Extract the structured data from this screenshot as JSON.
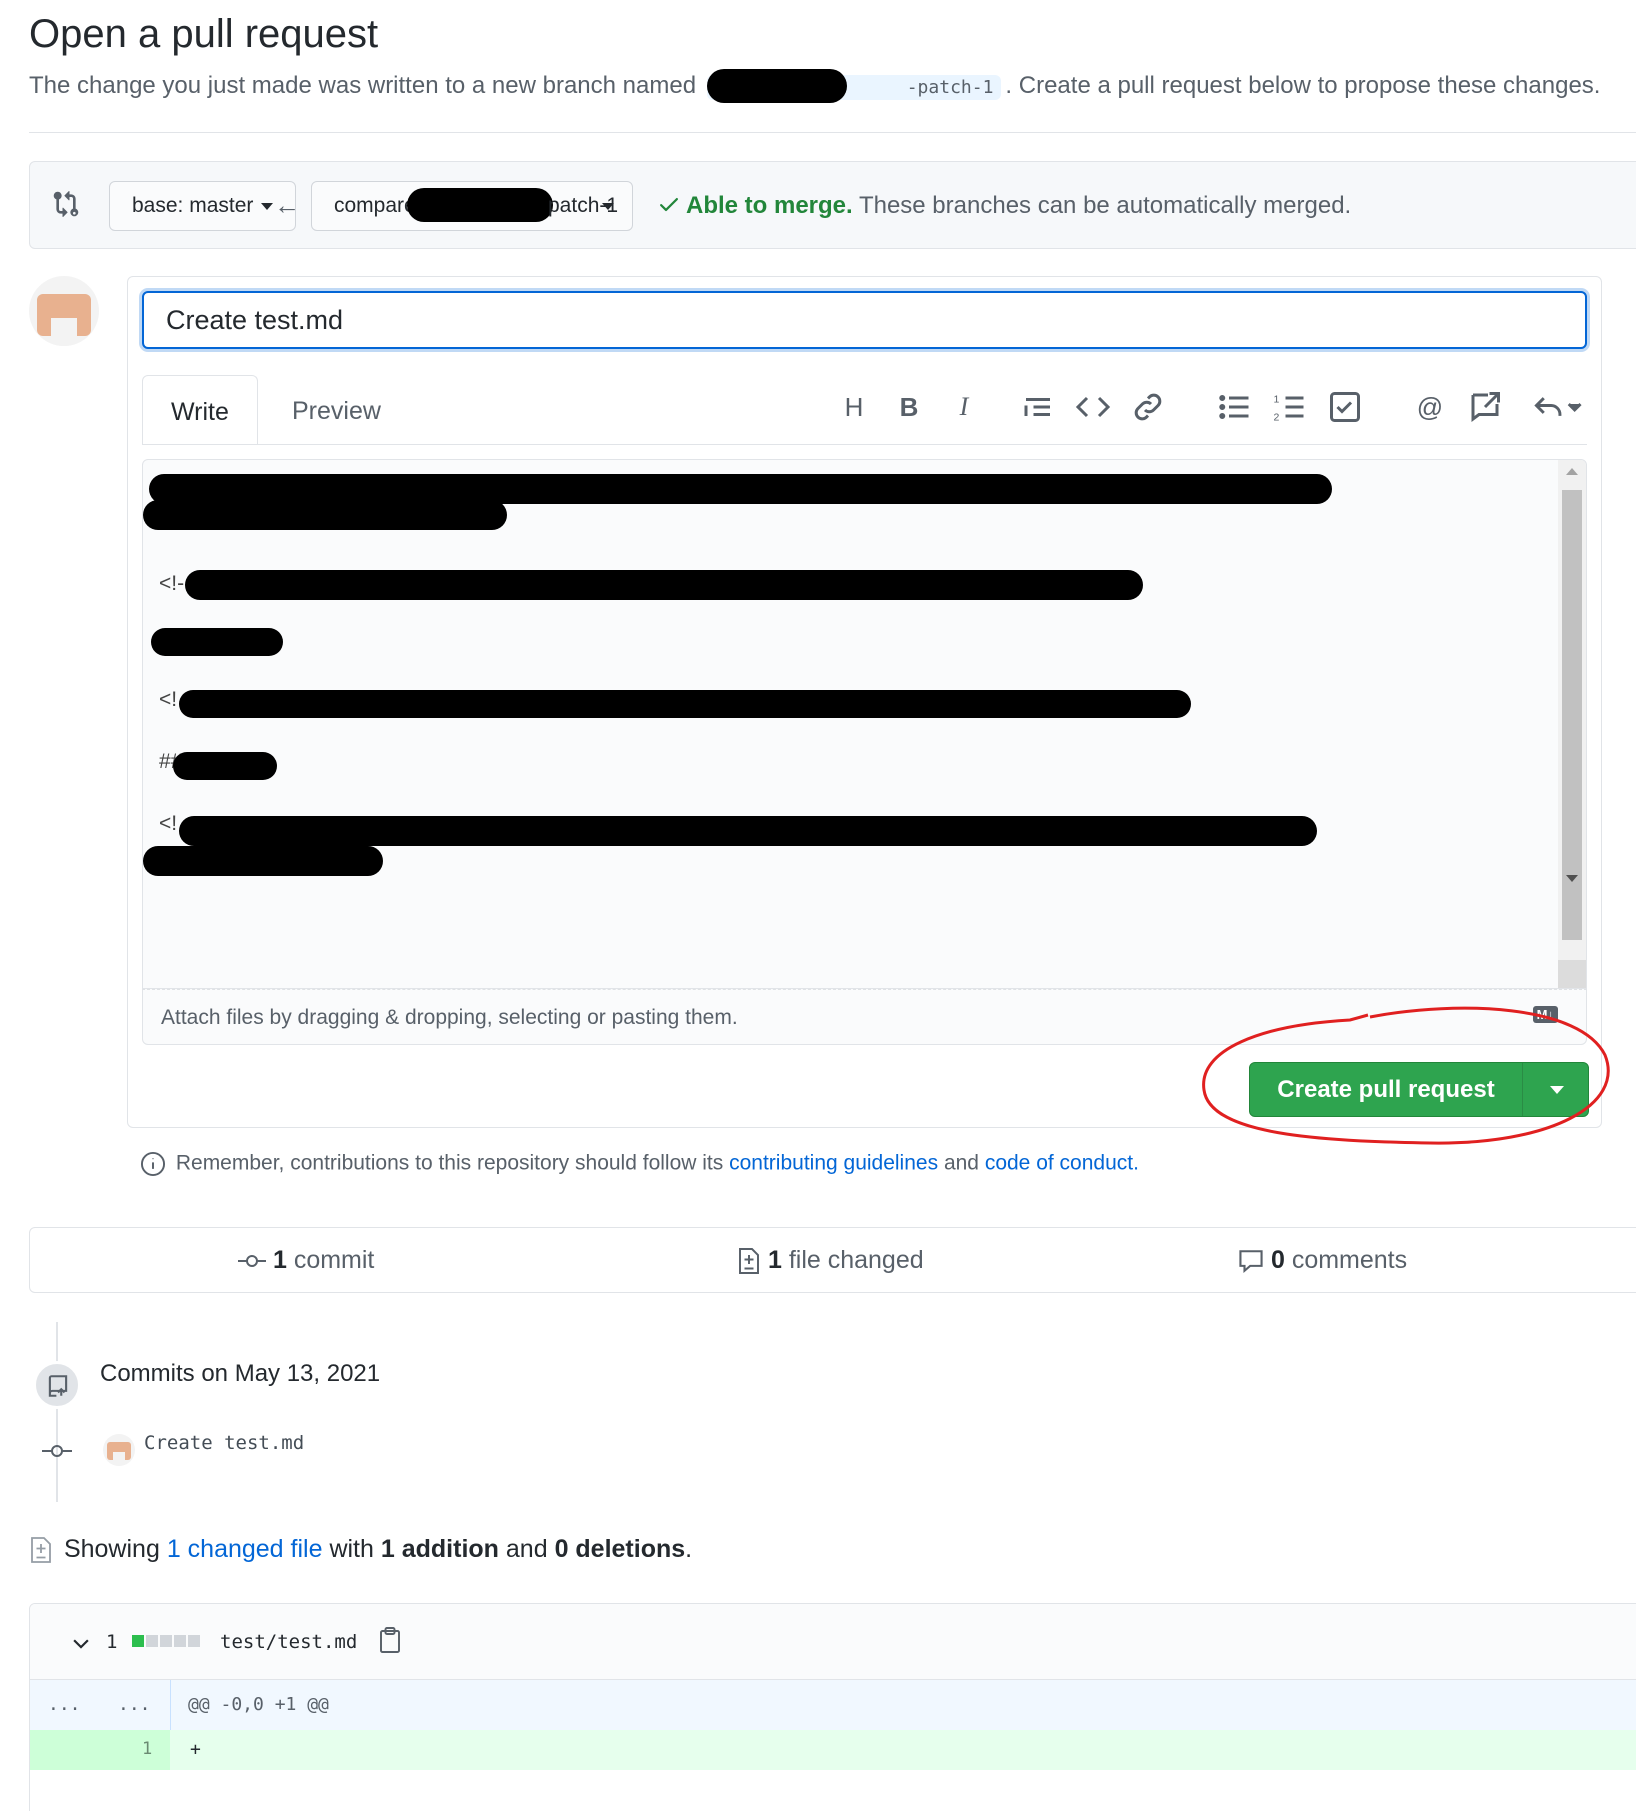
{
  "header": {
    "title": "Open a pull request",
    "subtitle_before": "The change you just made was written to a new branch named",
    "branch_suffix": "-patch-1",
    "subtitle_after": ". Create a pull request below to propose these changes."
  },
  "compare": {
    "base_label": "base: master",
    "compare_prefix": "compare",
    "compare_suffix": "patch-1",
    "merge_status": "Able to merge.",
    "merge_detail": "These branches can be automatically merged.",
    "status_color": "#22863a"
  },
  "form": {
    "title_value": "Create test.md",
    "tabs": [
      "Write",
      "Preview"
    ],
    "toolbar": [
      "heading-icon",
      "bold-icon",
      "italic-icon",
      "quote-icon",
      "code-icon",
      "link-icon",
      "unordered-list-icon",
      "ordered-list-icon",
      "task-list-icon",
      "mention-icon",
      "reference-icon",
      "reply-icon"
    ],
    "body_lines": [
      "<!-",
      "<!",
      "##",
      "<!"
    ],
    "attach_hint": "Attach files by dragging & dropping, selecting or pasting them.",
    "markdown_badge": "M↓",
    "submit_label": "Create pull request",
    "button_color": "#2ea44f"
  },
  "remember": {
    "prefix": "Remember, contributions to this repository should follow its",
    "link1": "contributing guidelines",
    "middle": "and",
    "link2": "code of conduct",
    "suffix": "."
  },
  "stats": {
    "commits_count": "1",
    "commits_label": "commit",
    "files_count": "1",
    "files_label": "file changed",
    "comments_count": "0",
    "comments_label": "comments"
  },
  "timeline": {
    "date_heading": "Commits on May 13, 2021",
    "commit_message": "Create test.md"
  },
  "summary": {
    "showing": "Showing",
    "changed_link": "1 changed file",
    "with": "with",
    "additions": "1 addition",
    "and": "and",
    "deletions": "0 deletions",
    "period": "."
  },
  "diff": {
    "count": "1",
    "file_path": "test/test.md",
    "hunk_left": "...",
    "hunk_right": "...",
    "hunk_header": "@@ -0,0 +1 @@",
    "line_number": "1",
    "line_content": "+"
  }
}
